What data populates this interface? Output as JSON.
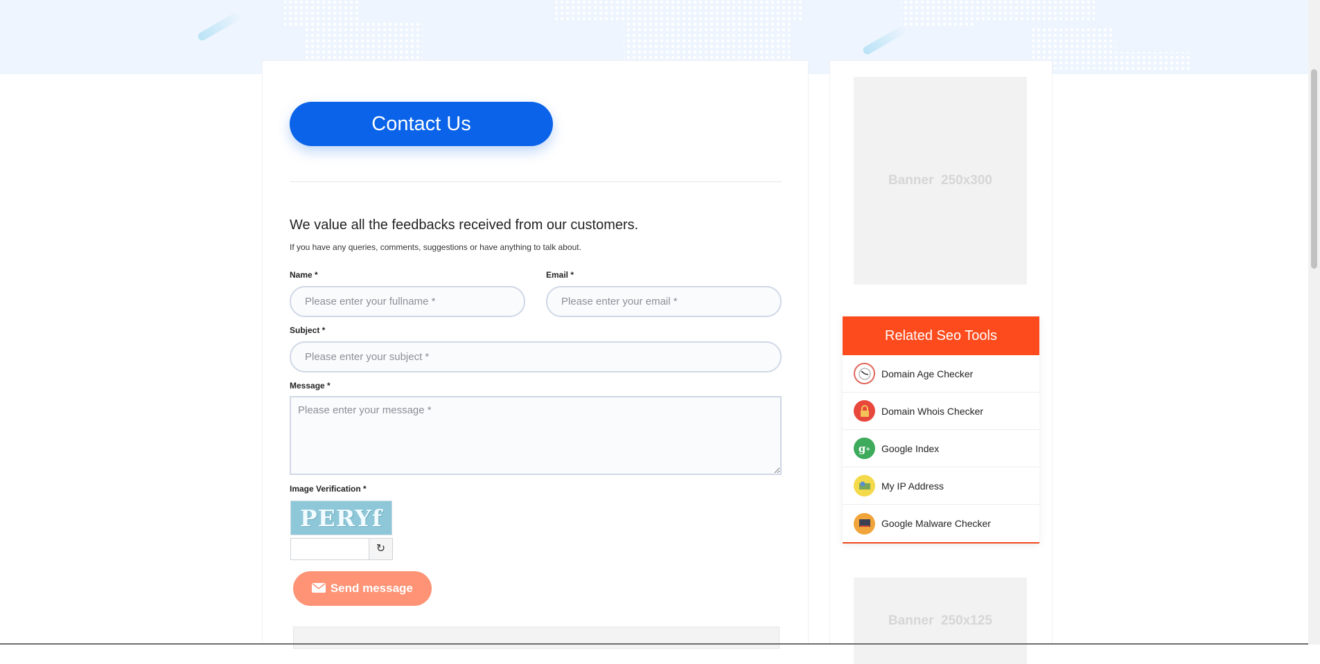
{
  "main": {
    "title_button": "Contact Us",
    "lead": "We value all the feedbacks received from our customers.",
    "sublead": "If you have any queries, comments, suggestions or have anything to talk about.",
    "form": {
      "name_label": "Name *",
      "name_placeholder": "Please enter your fullname *",
      "email_label": "Email *",
      "email_placeholder": "Please enter your email *",
      "subject_label": "Subject *",
      "subject_placeholder": "Please enter your subject *",
      "message_label": "Message *",
      "message_placeholder": "Please enter your message *",
      "captcha_label": "Image Verification *",
      "captcha_text": "PERYf",
      "refresh_icon": "refresh-icon",
      "send_label": "Send message",
      "send_icon": "envelope-icon"
    }
  },
  "sidebar": {
    "banner_top": "Banner  250x300",
    "related_title": "Related Seo Tools",
    "tools": [
      {
        "label": "Domain Age Checker",
        "icon": "clock-icon",
        "color": "#ffffff"
      },
      {
        "label": "Domain Whois Checker",
        "icon": "lock-icon",
        "color": "#e8473b"
      },
      {
        "label": "Google Index",
        "icon": "google-plus-icon",
        "color": "#3daa5c"
      },
      {
        "label": "My IP Address",
        "icon": "ip-map-icon",
        "color": "#f4d94a"
      },
      {
        "label": "Google Malware Checker",
        "icon": "monitor-icon",
        "color": "#f1a43a"
      }
    ],
    "banner_bottom": "Banner  250x125"
  },
  "colors": {
    "primary": "#0a63e8",
    "accent": "#fe4b1d",
    "send": "#fe9376"
  }
}
